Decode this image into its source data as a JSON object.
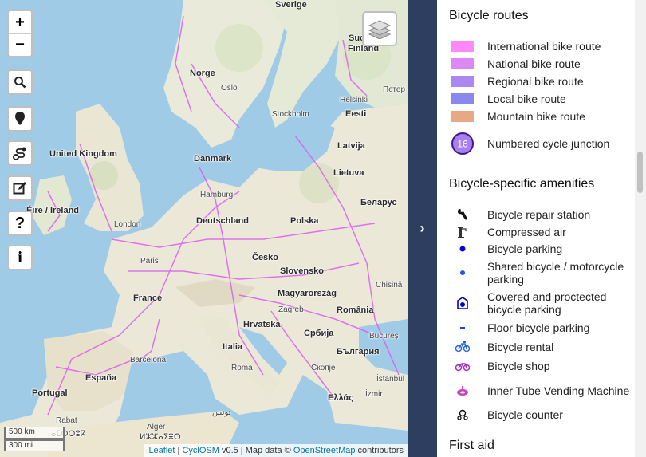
{
  "map": {
    "labels": {
      "sverige": "Sverige",
      "suomi": "Suo",
      "finland": "Finland",
      "norge": "Norge",
      "oslo": "Oslo",
      "helsinki": "Helsinki",
      "peterburg": "Петер",
      "stockholm": "Stockholm",
      "eesti": "Eesti",
      "united_kingdom": "United Kingdom",
      "latvija": "Latvija",
      "danmark": "Danmark",
      "lietuva": "Lietuva",
      "eire": "Éire / Ireland",
      "hamburg": "Hamburg",
      "belarus": "Беларус",
      "london": "London",
      "deutschland": "Deutschland",
      "polska": "Polska",
      "paris": "Paris",
      "cesko": "Česko",
      "slovensko": "Slovensko",
      "chisinau": "Chisină",
      "france": "France",
      "magyarorszag": "Magyarország",
      "zagreb": "Zagreb",
      "romania": "România",
      "hrvatska": "Hrvatska",
      "srbija": "Србија",
      "bucuresti": "Bucureș",
      "italia": "Italia",
      "balgaria": "България",
      "barcelona": "Barcelona",
      "roma": "Roma",
      "skopje": "Скопје",
      "espana": "España",
      "istanbul": "İstanbul",
      "portugal": "Portugal",
      "ellas": "Ελλάς",
      "izmir": "İzmir",
      "tunis": "تونس",
      "alger": "Alger",
      "rabat": "Rabat",
      "algeria": "ⵍⵣⵣⴰⵢⴻⵔ",
      "maroc": "ⴰⵎⵔⵔⵓⴽ"
    },
    "controls": {
      "zoom_in": "+",
      "zoom_out": "−",
      "search_icon": "search-icon",
      "marker_icon": "location-pin-icon",
      "route_icon": "route-icon",
      "edit_icon": "edit-icon",
      "help": "?",
      "info": "i"
    },
    "scale": {
      "km": "500 km",
      "mi": "300 mi"
    },
    "attribution": {
      "leaflet": "Leaflet",
      "sep1": " | ",
      "cyclosm": "CyclOSM",
      "version": " v0.5 | Map data © ",
      "osm": "OpenStreetMap",
      "contributors": " contributors"
    }
  },
  "divider": {
    "chevron": "›"
  },
  "legend": {
    "section_routes": "Bicycle routes",
    "routes": [
      {
        "label": "International bike route",
        "color": "#ff88ff"
      },
      {
        "label": "National bike route",
        "color": "#dd88f5"
      },
      {
        "label": "Regional bike route",
        "color": "#aa88f0"
      },
      {
        "label": "Local bike route",
        "color": "#8888ee"
      },
      {
        "label": "Mountain bike route",
        "color": "#e8a884"
      }
    ],
    "junction": {
      "number": "16",
      "label": "Numbered cycle junction"
    },
    "section_amenities": "Bicycle-specific amenities",
    "amenities": [
      {
        "label": "Bicycle repair station",
        "icon": "wrench-icon"
      },
      {
        "label": "Compressed air",
        "icon": "air-pump-icon"
      },
      {
        "label": "Bicycle parking",
        "icon": "blue-dot-icon"
      },
      {
        "label": "Shared bicycle / motorcycle parking",
        "icon": "blue-dot-small-icon"
      },
      {
        "label": "Covered and proctected bicycle parking",
        "icon": "covered-parking-icon"
      },
      {
        "label": "Floor bicycle parking",
        "icon": "floor-parking-icon"
      },
      {
        "label": "Bicycle rental",
        "icon": "bicycle-rental-icon"
      },
      {
        "label": "Bicycle shop",
        "icon": "bicycle-shop-icon"
      },
      {
        "label": "Inner Tube Vending Machine",
        "icon": "tube-vending-icon"
      },
      {
        "label": "Bicycle counter",
        "icon": "bicycle-counter-icon"
      }
    ],
    "section_first_aid": "First aid"
  }
}
